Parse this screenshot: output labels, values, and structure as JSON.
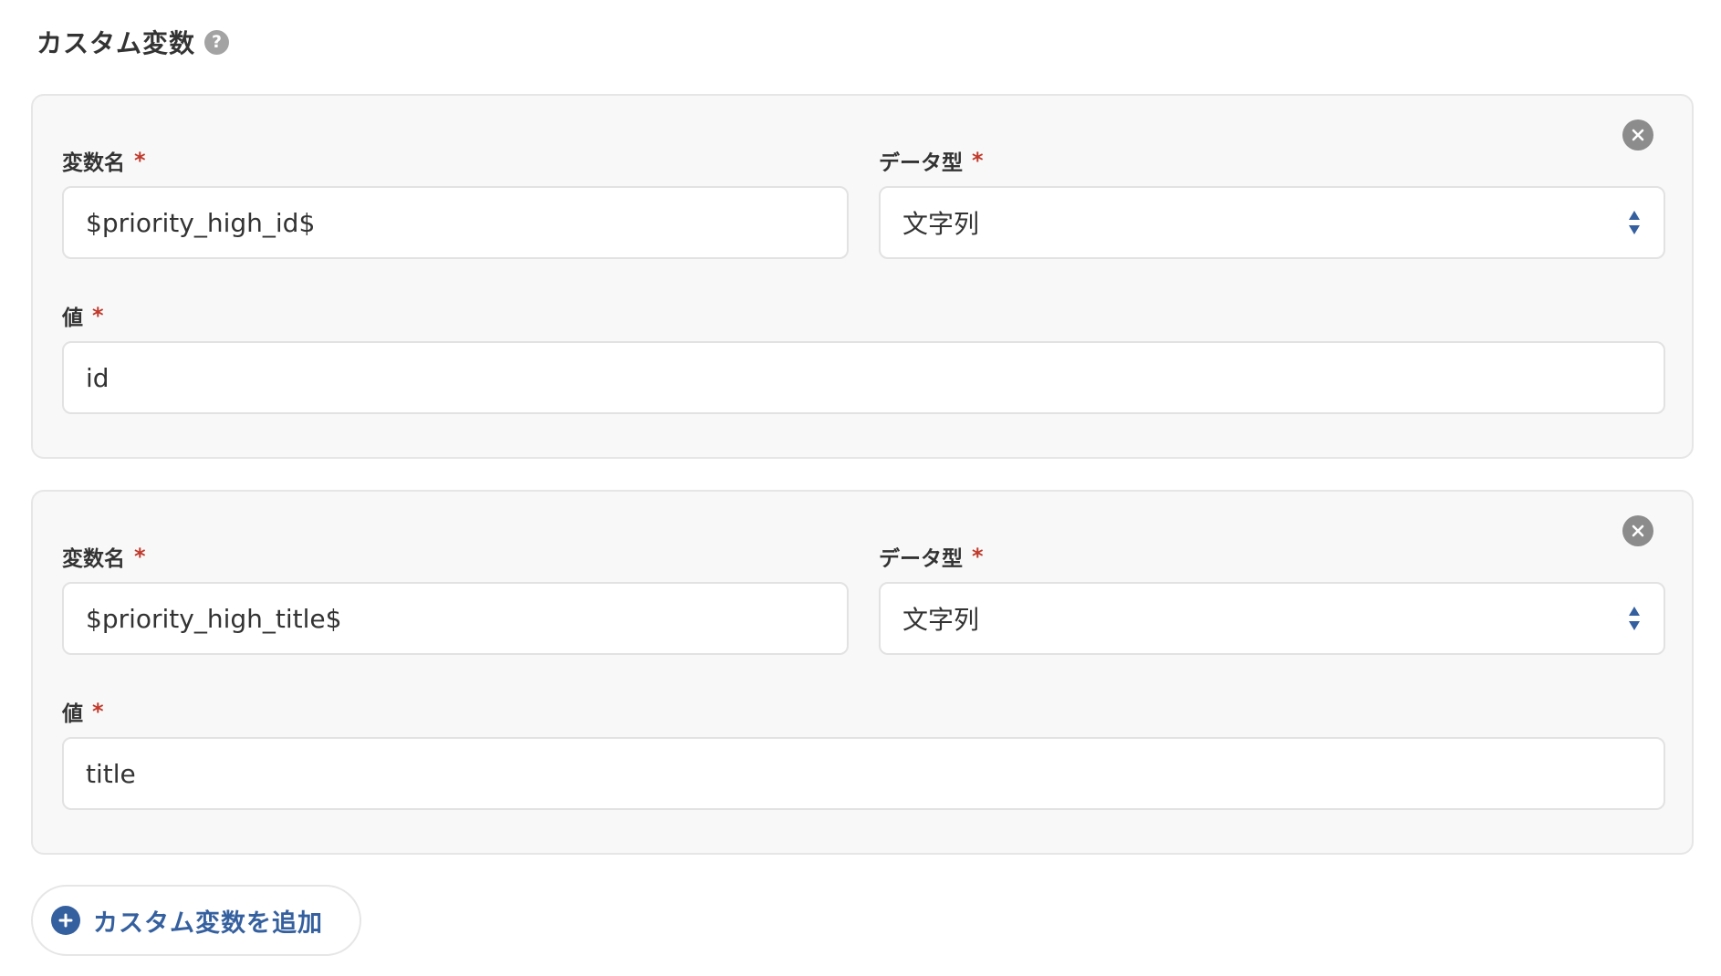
{
  "section": {
    "title": "カスタム変数",
    "help_icon": "question-circle-icon"
  },
  "variables": [
    {
      "name_label": "変数名",
      "type_label": "データ型",
      "value_label": "値",
      "required_mark": "*",
      "name_value": "$priority_high_id$",
      "type_value": "文字列",
      "value": "id",
      "remove_icon": "close-circle-icon"
    },
    {
      "name_label": "変数名",
      "type_label": "データ型",
      "value_label": "値",
      "required_mark": "*",
      "name_value": "$priority_high_title$",
      "type_value": "文字列",
      "value": "title",
      "remove_icon": "close-circle-icon"
    }
  ],
  "add_button": {
    "label": "カスタム変数を追加",
    "icon": "plus-circle-icon"
  },
  "colors": {
    "accent": "#35609f",
    "required": "#c0392b",
    "card_bg": "#f8f8f8",
    "icon_gray": "#8c8c8c"
  }
}
